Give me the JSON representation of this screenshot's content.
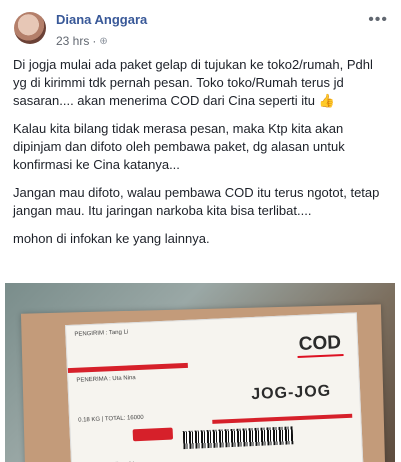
{
  "author": "Diana Anggara",
  "timestamp": "23 hrs",
  "privacy_icon": "globe-icon",
  "more_label": "•••",
  "paragraphs": [
    "Di jogja mulai ada paket gelap di tujukan ke toko2/rumah, Pdhl yg di kirimmi tdk pernah pesan. Toko toko/Rumah terus jd sasaran.... akan menerima COD dari Cina seperti itu 👍",
    "Kalau kita bilang tidak merasa pesan, maka Ktp kita akan dipinjam dan difoto oleh pembawa paket, dg alasan untuk konfirmasi ke Cina katanya...",
    "Jangan mau difoto, walau pembawa COD itu terus ngotot, tetap jangan mau. Itu jaringan narkoba kita bisa terlibat....",
    "mohon di infokan ke yang lainnya."
  ],
  "photo": {
    "label_cod": "COD",
    "label_dest": "JOG-JOG",
    "sender_line": "PENGIRIM : Tang Li",
    "receiver_line": "PENERIMA : Uta Nina",
    "weight_line": "0.18 KG | TOTAL: 16000"
  }
}
